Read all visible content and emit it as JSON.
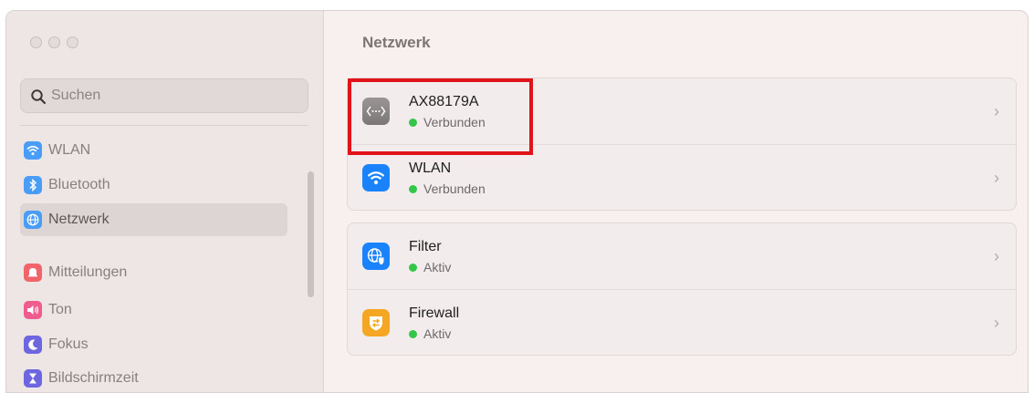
{
  "window": {
    "title": "Netzwerk"
  },
  "search": {
    "placeholder": "Suchen"
  },
  "sidebar": {
    "items": [
      {
        "label": "WLAN",
        "icon": "wifi-icon",
        "color": "#4a9df7",
        "selected": false
      },
      {
        "label": "Bluetooth",
        "icon": "bluetooth-icon",
        "color": "#4a9df7",
        "selected": false
      },
      {
        "label": "Netzwerk",
        "icon": "globe-icon",
        "color": "#4a9df7",
        "selected": true
      },
      {
        "label": "Mitteilungen",
        "icon": "bell-icon",
        "color": "#f0646a",
        "selected": false
      },
      {
        "label": "Ton",
        "icon": "speaker-icon",
        "color": "#ef5d8f",
        "selected": false
      },
      {
        "label": "Fokus",
        "icon": "moon-icon",
        "color": "#6e66e0",
        "selected": false
      },
      {
        "label": "Bildschirmzeit",
        "icon": "hourglass-icon",
        "color": "#6e66e0",
        "selected": false
      }
    ]
  },
  "groups": [
    {
      "rows": [
        {
          "title": "AX88179A",
          "status": "Verbunden",
          "icon": "ethernet-icon",
          "status_color": "#33c748"
        },
        {
          "title": "WLAN",
          "status": "Verbunden",
          "icon": "wifi-icon",
          "status_color": "#33c748"
        }
      ]
    },
    {
      "rows": [
        {
          "title": "Filter",
          "status": "Aktiv",
          "icon": "globe-shield-icon",
          "status_color": "#33c748"
        },
        {
          "title": "Firewall",
          "status": "Aktiv",
          "icon": "firewall-icon",
          "status_color": "#33c748"
        }
      ]
    }
  ],
  "colors": {
    "accent": "#1a82fb",
    "highlight": "#e0131b",
    "firewall": "#f5a623"
  }
}
